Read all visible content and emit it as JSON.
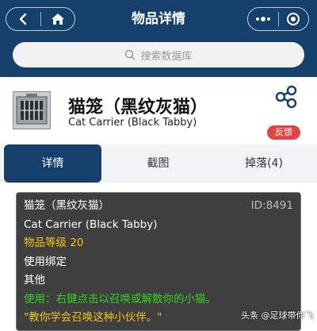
{
  "header": {
    "title": "物品详情"
  },
  "search": {
    "placeholder": "搜索数据库"
  },
  "item": {
    "name_cn": "猫笼（黑纹灰猫）",
    "name_en": "Cat Carrier (Black Tabby)",
    "report_label": "反馈"
  },
  "tabs": [
    {
      "label": "详情",
      "active": true
    },
    {
      "label": "截图",
      "active": false
    },
    {
      "label": "掉落(4)",
      "active": false
    }
  ],
  "tooltip": {
    "title": "猫笼（黑纹灰猫）",
    "id": "ID:8491",
    "english": "Cat Carrier (Black Tabby)",
    "item_level": "物品等级 20",
    "binding": "使用绑定",
    "category": "其他",
    "use_text": "使用：右键点击以召唤或解散你的小猫。",
    "flavor": "\"教你学会召唤这种小伙伴。\""
  },
  "watermark": "头条 @足球带你飞",
  "colors": {
    "primary": "#16406c",
    "report": "#e04444",
    "item_level": "#f0c419",
    "use_text": "#33d11e"
  }
}
